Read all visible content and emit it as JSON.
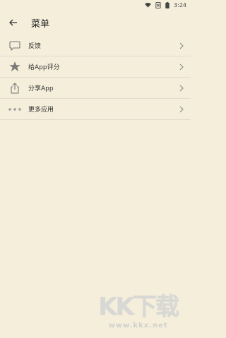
{
  "status": {
    "time": "3:24"
  },
  "app_bar": {
    "title": "菜单"
  },
  "menu": {
    "items": [
      {
        "label": "反馈",
        "icon": "chat-bubble-icon"
      },
      {
        "label": "给App评分",
        "icon": "star-icon"
      },
      {
        "label": "分享App",
        "icon": "share-icon"
      },
      {
        "label": "更多应用",
        "icon": "more-dots-icon"
      }
    ]
  },
  "watermark": {
    "brand": "KK下载",
    "url": "www.kkx.net"
  }
}
